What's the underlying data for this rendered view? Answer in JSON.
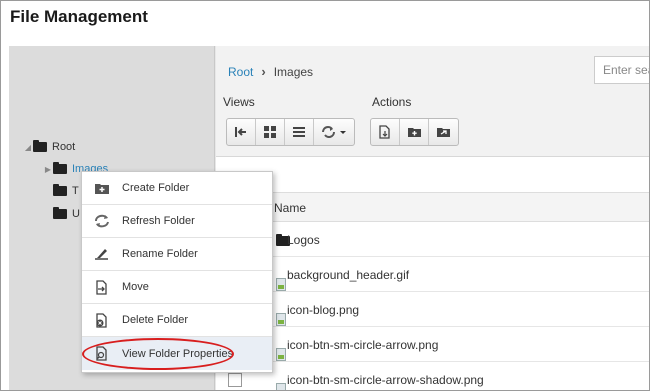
{
  "app": {
    "title": "File Management"
  },
  "tree": {
    "root_label": "Root",
    "nodes": [
      {
        "label": "Images",
        "selected": true
      },
      {
        "label": "T"
      },
      {
        "label": "U"
      }
    ]
  },
  "breadcrumb": {
    "root": "Root",
    "separator": "›",
    "current": "Images"
  },
  "search": {
    "placeholder": "Enter search"
  },
  "toolbar": {
    "views_label": "Views",
    "actions_label": "Actions",
    "view_buttons": [
      "back-arrow-icon",
      "grid-view-icon",
      "list-view-icon",
      "refresh-dropdown-icon"
    ],
    "action_buttons": [
      "new-file-icon",
      "new-folder-icon",
      "upload-icon"
    ]
  },
  "grid": {
    "column_name": "Name",
    "rows": [
      {
        "name": "Logos",
        "type": "folder"
      },
      {
        "name": "background_header.gif",
        "type": "file"
      },
      {
        "name": "icon-blog.png",
        "type": "file"
      },
      {
        "name": "icon-btn-sm-circle-arrow.png",
        "type": "file"
      },
      {
        "name": "icon-btn-sm-circle-arrow-shadow.png",
        "type": "file"
      }
    ]
  },
  "context_menu": {
    "items": [
      {
        "label": "Create Folder",
        "icon": "create-folder-icon"
      },
      {
        "label": "Refresh Folder",
        "icon": "refresh-icon"
      },
      {
        "label": "Rename Folder",
        "icon": "rename-icon"
      },
      {
        "label": "Move",
        "icon": "move-icon"
      },
      {
        "label": "Delete Folder",
        "icon": "delete-icon"
      },
      {
        "label": "View Folder Properties",
        "icon": "properties-icon",
        "highlighted": true
      }
    ]
  },
  "colors": {
    "link": "#2a82b8",
    "highlight_oval": "#d81e1e",
    "menu_highlight": "#e9eef5"
  }
}
